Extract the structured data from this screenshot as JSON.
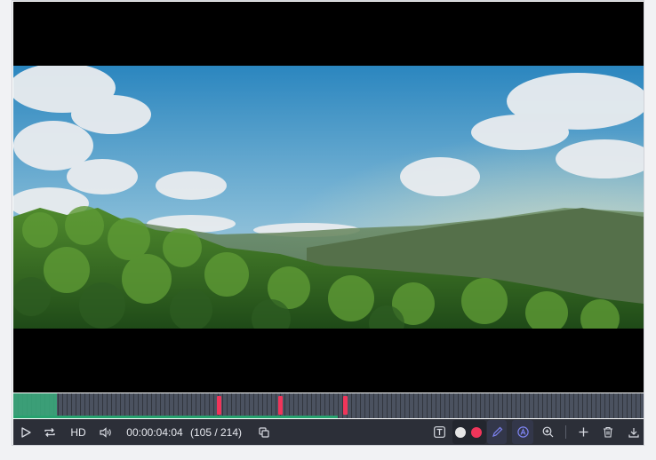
{
  "player": {
    "quality_label": "HD",
    "timecode": "00:00:04:04",
    "frame_counter": "(105 / 214)",
    "progress_fraction": 0.49
  },
  "timeline": {
    "marker_frames": [
      69,
      90,
      112
    ]
  },
  "colors": {
    "accent_red": "#f0355a",
    "accent_green": "#3aa67a",
    "swatch_white": "#e6e6e6",
    "swatch_red": "#f0355a",
    "toolbar_bg": "#2c2f38"
  },
  "icons": {
    "play": "play-icon",
    "loop": "loop-icon",
    "volume": "volume-icon",
    "copy": "copy-icon",
    "text": "text-tool-icon",
    "pen": "pen-icon",
    "shape": "shape-tool-icon",
    "zoom": "zoom-in-icon",
    "add": "add-icon",
    "delete": "trash-icon",
    "download": "download-icon"
  }
}
